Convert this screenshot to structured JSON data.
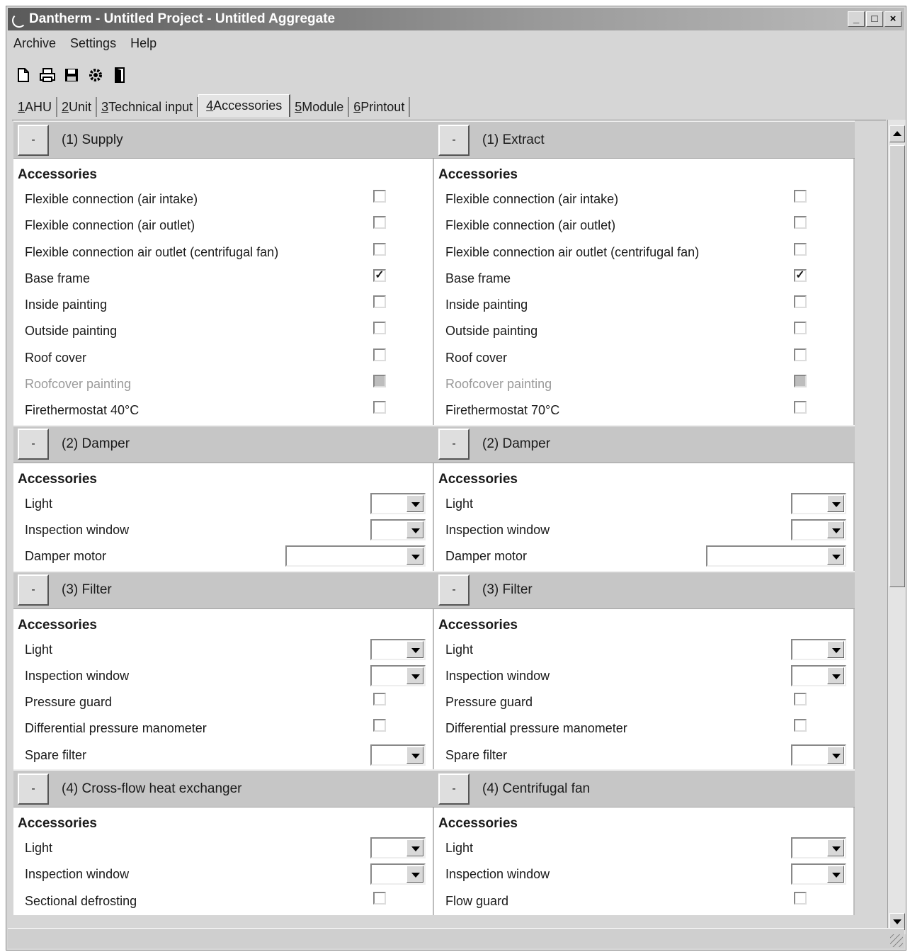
{
  "window": {
    "title": "Dantherm - Untitled Project - Untitled Aggregate",
    "controls": [
      "_",
      "□",
      "×"
    ]
  },
  "menu": [
    "Archive",
    "Settings",
    "Help"
  ],
  "toolbar": [
    "new-icon",
    "print-icon",
    "save-icon",
    "settings-icon",
    "exit-icon"
  ],
  "tabs": [
    {
      "num": "1",
      "label": " AHU"
    },
    {
      "num": "2",
      "label": " Unit"
    },
    {
      "num": "3",
      "label": " Technical input"
    },
    {
      "num": "4",
      "label": " Accessories"
    },
    {
      "num": "5",
      "label": " Module"
    },
    {
      "num": "6",
      "label": " Printout"
    }
  ],
  "active_tab": 3,
  "collapse_symbol": "-",
  "accessories_label": "Accessories",
  "columns": [
    {
      "sections": [
        {
          "title": "(1)  Supply",
          "rows": [
            {
              "label": "Flexible connection (air intake)",
              "control": "checkbox",
              "checked": false
            },
            {
              "label": "Flexible connection (air outlet)",
              "control": "checkbox",
              "checked": false
            },
            {
              "label": "Flexible connection air outlet (centrifugal fan)",
              "control": "checkbox",
              "checked": false
            },
            {
              "label": "Base frame",
              "control": "checkbox",
              "checked": true
            },
            {
              "label": "Inside painting",
              "control": "checkbox",
              "checked": false
            },
            {
              "label": "Outside painting",
              "control": "checkbox",
              "checked": false
            },
            {
              "label": "Roof cover",
              "control": "checkbox",
              "checked": false
            },
            {
              "label": "Roofcover painting",
              "control": "checkbox",
              "checked": false,
              "disabled": true
            },
            {
              "label": "Firethermostat 40°C",
              "control": "checkbox",
              "checked": false
            }
          ]
        },
        {
          "title": "(2)  Damper",
          "rows": [
            {
              "label": "Light",
              "control": "dropdown",
              "size": "small"
            },
            {
              "label": "Inspection window",
              "control": "dropdown",
              "size": "small"
            },
            {
              "label": "Damper motor",
              "control": "dropdown",
              "size": "wide"
            }
          ]
        },
        {
          "title": "(3)  Filter",
          "rows": [
            {
              "label": "Light",
              "control": "dropdown",
              "size": "small"
            },
            {
              "label": "Inspection window",
              "control": "dropdown",
              "size": "small"
            },
            {
              "label": "Pressure guard",
              "control": "checkbox",
              "checked": false
            },
            {
              "label": "Differential pressure manometer",
              "control": "checkbox",
              "checked": false
            },
            {
              "label": "Spare filter",
              "control": "dropdown",
              "size": "small"
            }
          ]
        },
        {
          "title": "(4)  Cross-flow heat exchanger",
          "rows": [
            {
              "label": "Light",
              "control": "dropdown",
              "size": "small"
            },
            {
              "label": "Inspection window",
              "control": "dropdown",
              "size": "small"
            },
            {
              "label": "Sectional defrosting",
              "control": "checkbox",
              "checked": false
            }
          ]
        }
      ]
    },
    {
      "sections": [
        {
          "title": "(1)  Extract",
          "rows": [
            {
              "label": "Flexible connection (air intake)",
              "control": "checkbox",
              "checked": false
            },
            {
              "label": "Flexible connection (air outlet)",
              "control": "checkbox",
              "checked": false
            },
            {
              "label": "Flexible connection air outlet (centrifugal fan)",
              "control": "checkbox",
              "checked": false
            },
            {
              "label": "Base frame",
              "control": "checkbox",
              "checked": true
            },
            {
              "label": "Inside painting",
              "control": "checkbox",
              "checked": false
            },
            {
              "label": "Outside painting",
              "control": "checkbox",
              "checked": false
            },
            {
              "label": "Roof cover",
              "control": "checkbox",
              "checked": false
            },
            {
              "label": "Roofcover painting",
              "control": "checkbox",
              "checked": false,
              "disabled": true
            },
            {
              "label": "Firethermostat 70°C",
              "control": "checkbox",
              "checked": false
            }
          ]
        },
        {
          "title": "(2)  Damper",
          "rows": [
            {
              "label": "Light",
              "control": "dropdown",
              "size": "small"
            },
            {
              "label": "Inspection window",
              "control": "dropdown",
              "size": "small"
            },
            {
              "label": "Damper motor",
              "control": "dropdown",
              "size": "wide"
            }
          ]
        },
        {
          "title": "(3)  Filter",
          "rows": [
            {
              "label": "Light",
              "control": "dropdown",
              "size": "small"
            },
            {
              "label": "Inspection window",
              "control": "dropdown",
              "size": "small"
            },
            {
              "label": "Pressure guard",
              "control": "checkbox",
              "checked": false
            },
            {
              "label": "Differential pressure manometer",
              "control": "checkbox",
              "checked": false
            },
            {
              "label": "Spare filter",
              "control": "dropdown",
              "size": "small"
            }
          ]
        },
        {
          "title": "(4)  Centrifugal fan",
          "rows": [
            {
              "label": "Light",
              "control": "dropdown",
              "size": "small"
            },
            {
              "label": "Inspection window",
              "control": "dropdown",
              "size": "small"
            },
            {
              "label": "Flow guard",
              "control": "checkbox",
              "checked": false
            }
          ]
        }
      ]
    }
  ]
}
